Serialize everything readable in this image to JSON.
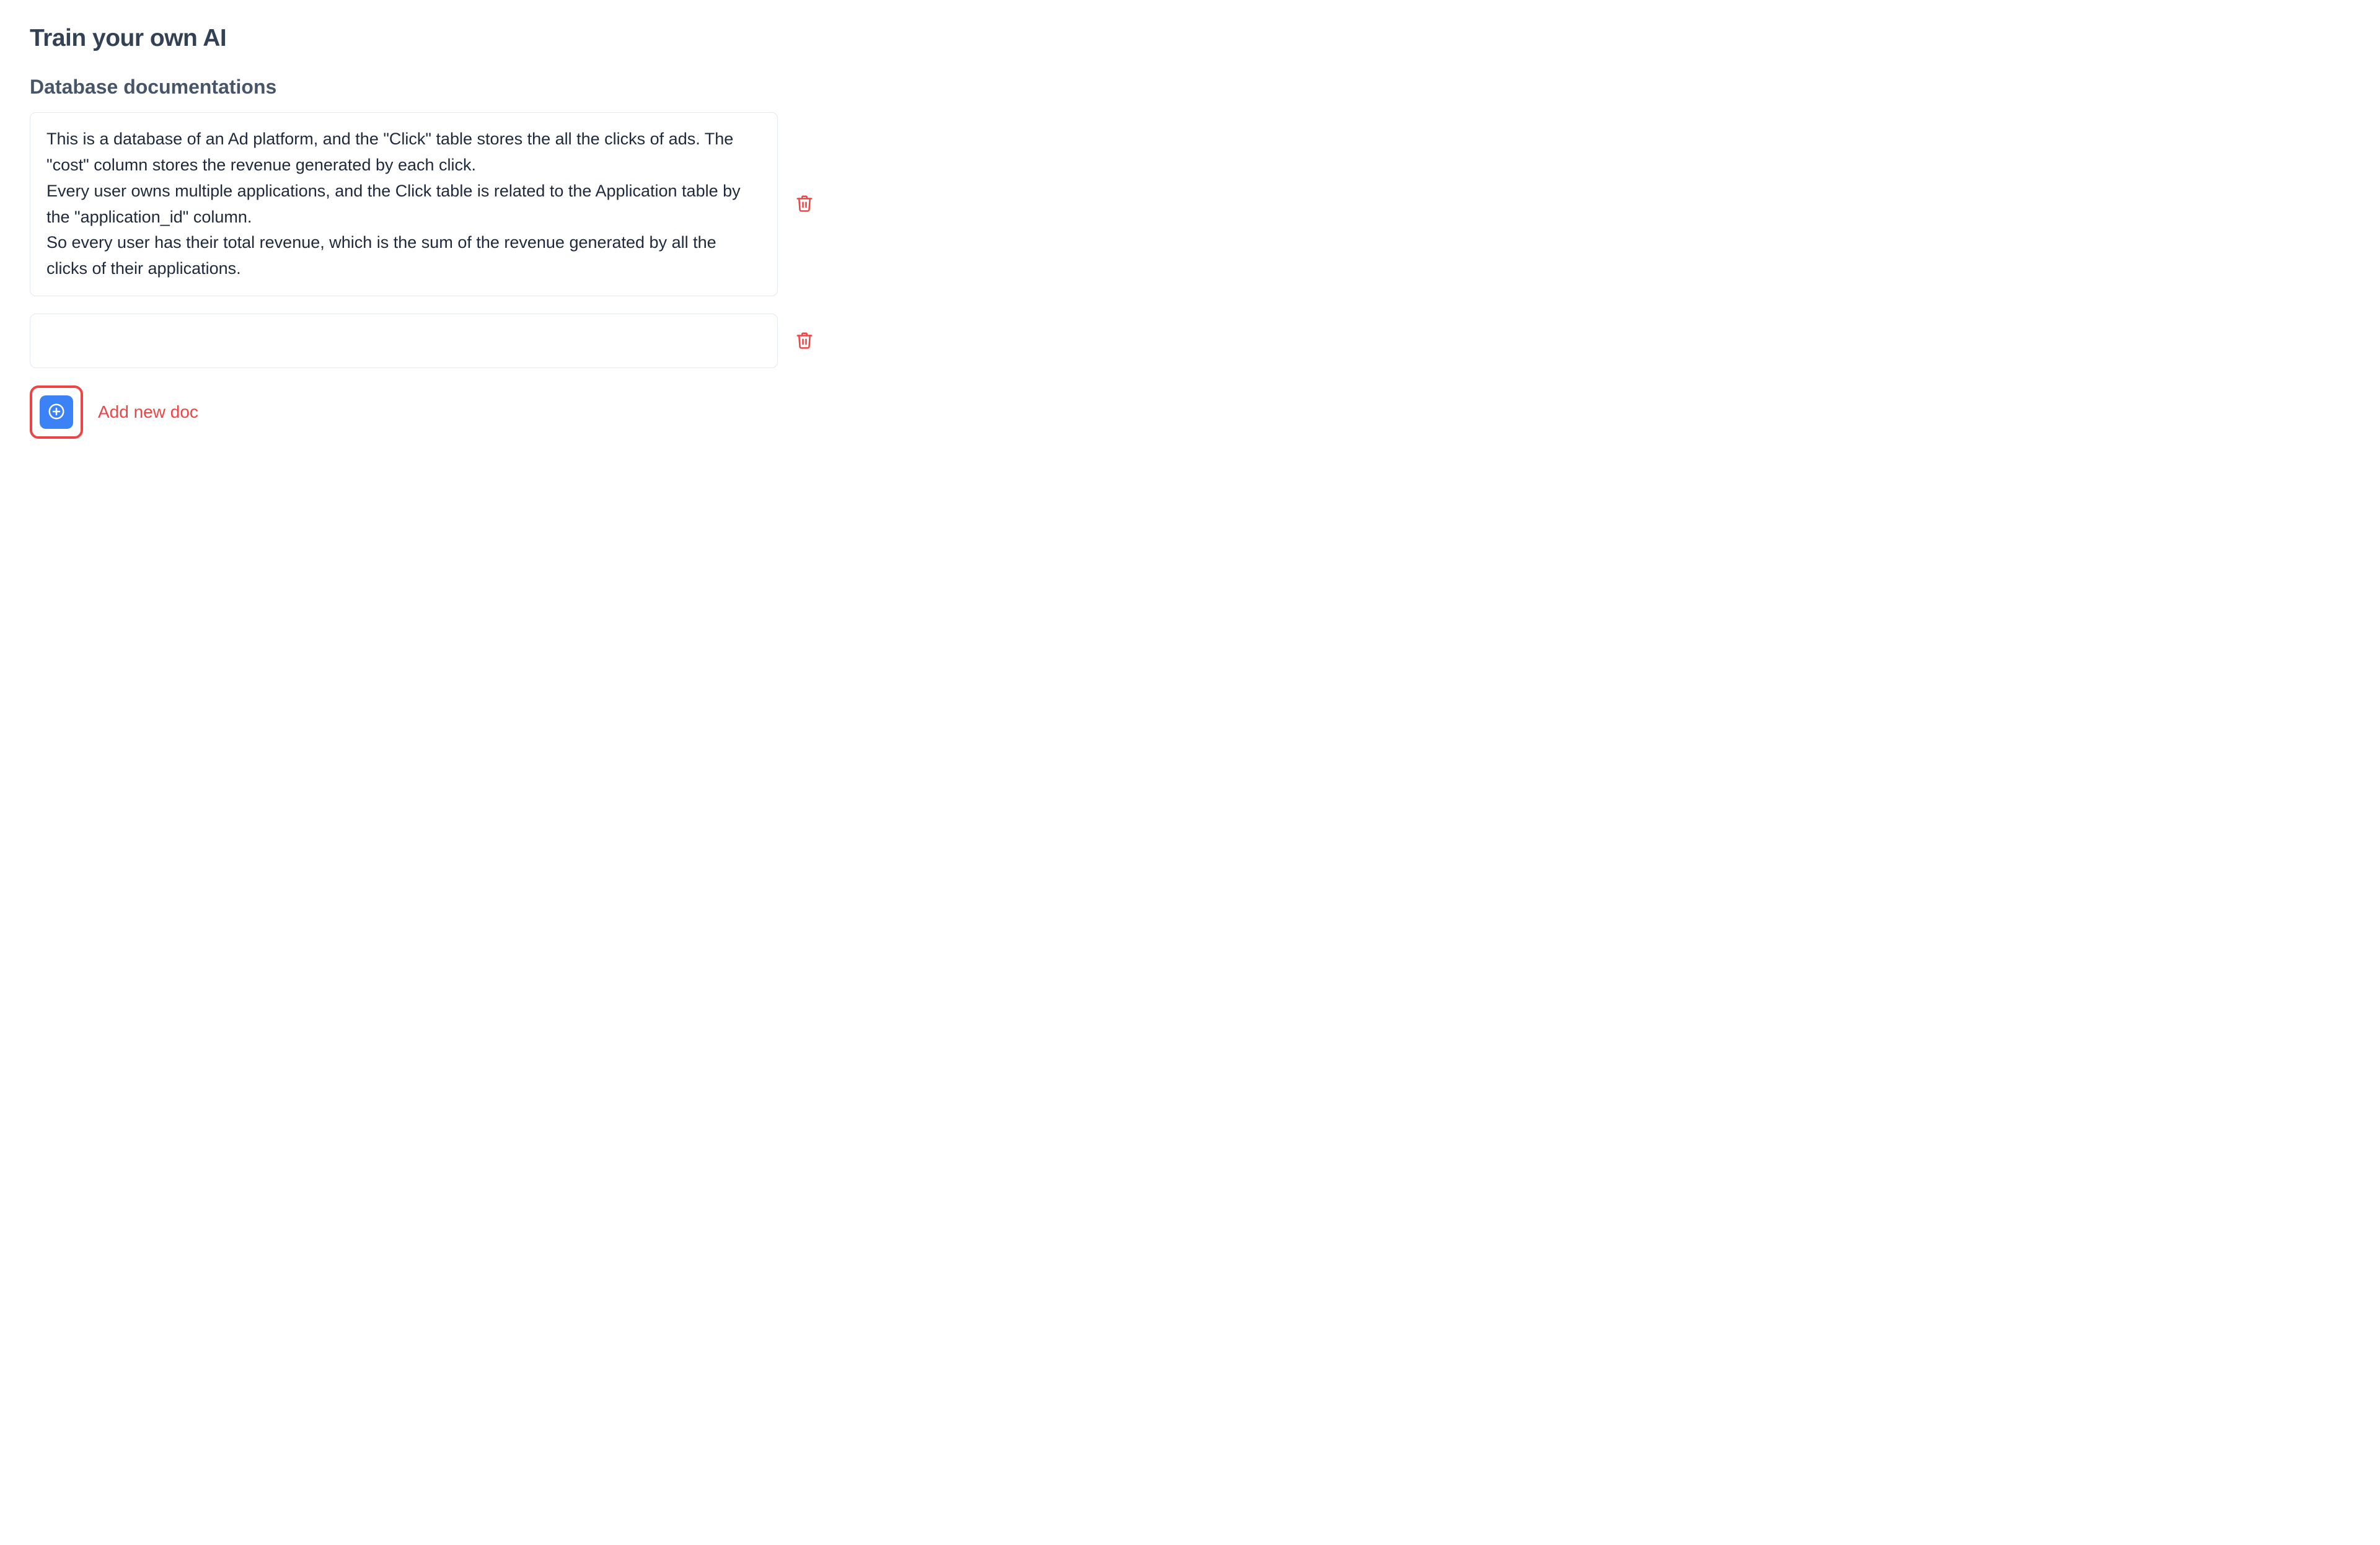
{
  "page": {
    "title": "Train your own AI"
  },
  "section": {
    "title": "Database documentations"
  },
  "docs": [
    {
      "text": "This is a database of an Ad platform, and the \"Click\" table stores the all the clicks of ads. The \"cost\" column stores the revenue generated by each click.\nEvery user owns multiple applications, and the Click table is related to the Application table by the \"application_id\" column.\nSo every user has their total revenue, which is the sum of the revenue generated by all the clicks of their applications."
    },
    {
      "text": ""
    }
  ],
  "add": {
    "label": "Add new doc"
  },
  "icons": {
    "trash": "trash-icon",
    "plus": "plus-circle-icon"
  },
  "colors": {
    "accent_blue": "#3b82f6",
    "accent_red": "#ef4444",
    "heading": "#334155",
    "subheading": "#475569"
  }
}
